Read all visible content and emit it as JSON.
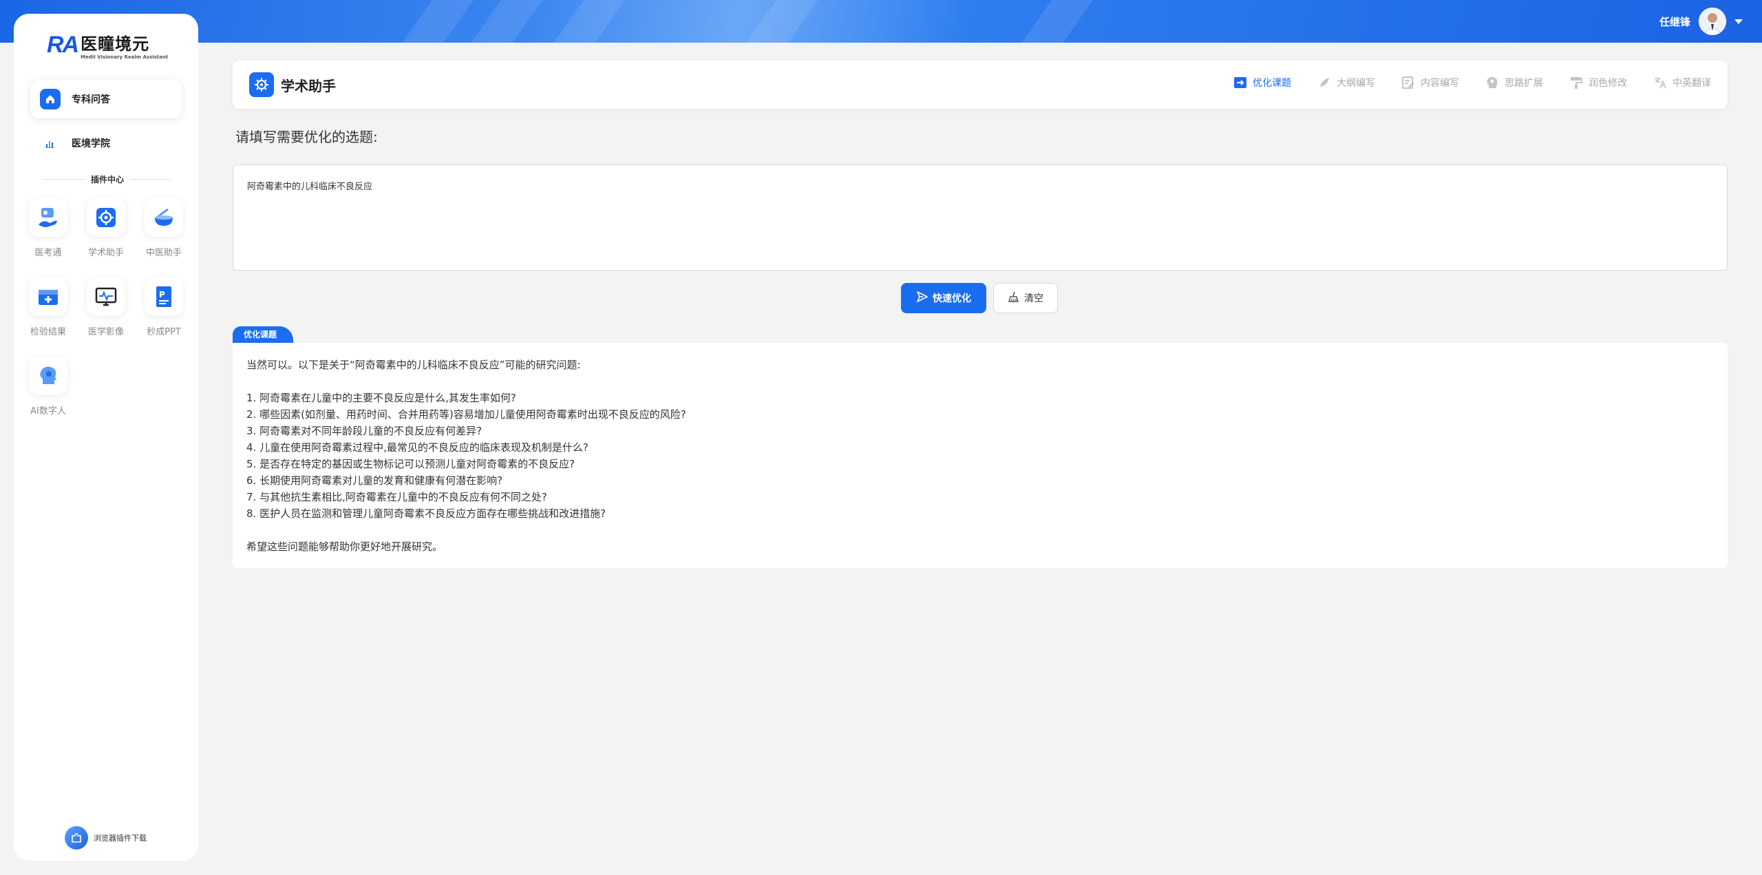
{
  "user": {
    "name": "任继锋"
  },
  "sidebar": {
    "logo_cn": "医瞳境元",
    "logo_en": "MediI Visionary Realm Assistant",
    "nav": [
      {
        "label": "专科问答",
        "icon": "home-icon"
      },
      {
        "label": "医境学院",
        "icon": "bar-chart-icon"
      }
    ],
    "plugin_center": "插件中心",
    "plugins": [
      {
        "label": "医考通",
        "icon": "doctor-exam-icon"
      },
      {
        "label": "学术助手",
        "icon": "gear-molecule-icon"
      },
      {
        "label": "中医助手",
        "icon": "herbal-bowl-icon"
      },
      {
        "label": "检验结果",
        "icon": "medical-box-icon"
      },
      {
        "label": "医学影像",
        "icon": "monitor-pulse-icon"
      },
      {
        "label": "秒成PPT",
        "icon": "ppt-file-icon"
      },
      {
        "label": "AI数字人",
        "icon": "ai-head-icon"
      }
    ],
    "browser_extension": "浏览器插件下载"
  },
  "header": {
    "title": "学术助手",
    "tabs": [
      {
        "label": "优化课题",
        "icon": "arrow-box-icon",
        "active": true
      },
      {
        "label": "大纲编写",
        "icon": "feather-icon",
        "active": false
      },
      {
        "label": "内容编写",
        "icon": "edit-doc-icon",
        "active": false
      },
      {
        "label": "思路扩展",
        "icon": "brain-head-icon",
        "active": false
      },
      {
        "label": "润色修改",
        "icon": "paint-roller-icon",
        "active": false
      },
      {
        "label": "中英翻译",
        "icon": "translate-icon",
        "active": false
      }
    ]
  },
  "main": {
    "prompt_label": "请填写需要优化的选题:",
    "input_value": "阿奇霉素中的儿科临床不良反应",
    "optimize_button": "快速优化",
    "clear_button": "清空",
    "result_tag": "优化课题",
    "result_lines": [
      "当然可以。以下是关于“阿奇霉素中的儿科临床不良反应”可能的研究问题:",
      "",
      "1. 阿奇霉素在儿童中的主要不良反应是什么,其发生率如何?",
      "2. 哪些因素(如剂量、用药时间、合并用药等)容易增加儿童使用阿奇霉素时出现不良反应的风险?",
      "3. 阿奇霉素对不同年龄段儿童的不良反应有何差异?",
      "4. 儿童在使用阿奇霉素过程中,最常见的不良反应的临床表现及机制是什么?",
      "5. 是否存在特定的基因或生物标记可以预测儿童对阿奇霉素的不良反应?",
      "6. 长期使用阿奇霉素对儿童的发育和健康有何潜在影响?",
      "7. 与其他抗生素相比,阿奇霉素在儿童中的不良反应有何不同之处?",
      "8. 医护人员在监测和管理儿童阿奇霉素不良反应方面存在哪些挑战和改进措施?",
      "",
      "希望这些问题能够帮助你更好地开展研究。"
    ]
  },
  "colors": {
    "accent": "#1b6df0",
    "background": "#f3f3f3"
  }
}
